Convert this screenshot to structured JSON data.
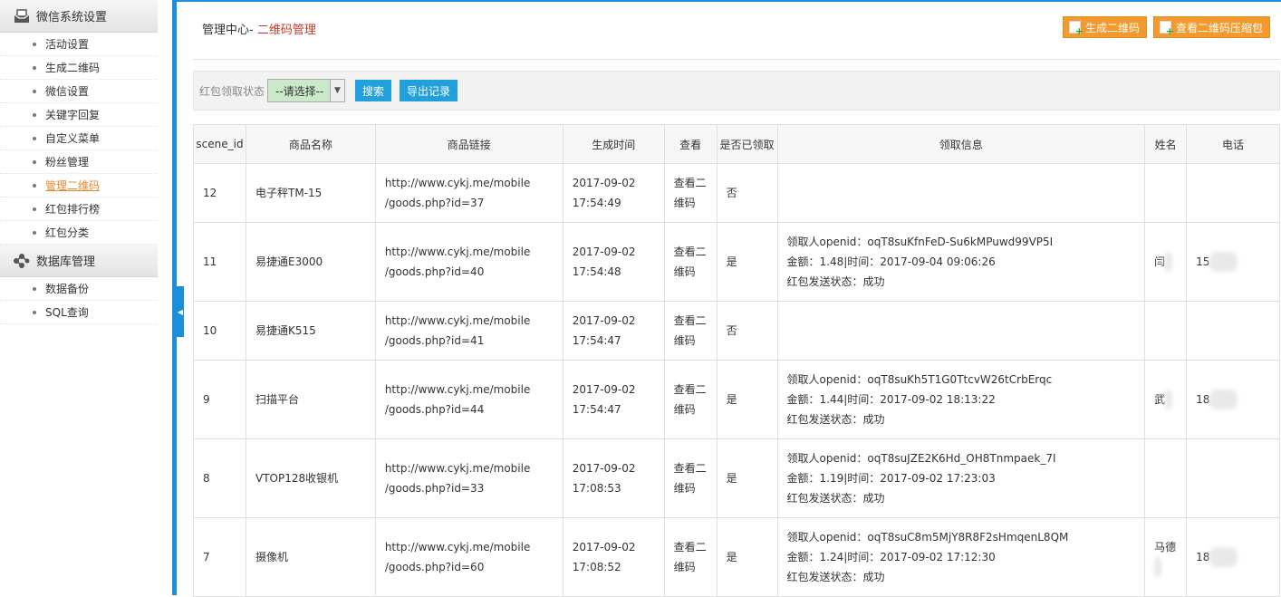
{
  "sidebar": {
    "groups": [
      {
        "title": "微信系统设置",
        "icon": "inbox-icon",
        "items": [
          "活动设置",
          "生成二维码",
          "微信设置",
          "关键字回复",
          "自定义菜单",
          "粉丝管理",
          "管理二维码",
          "红包排行榜",
          "红包分类"
        ]
      },
      {
        "title": "数据库管理",
        "icon": "share-nodes-icon",
        "items": [
          "数据备份",
          "SQL查询"
        ]
      }
    ],
    "active_item": "管理二维码"
  },
  "header": {
    "prefix": "管理中心-",
    "current": "二维码管理"
  },
  "actions": {
    "generate_qr": "生成二维码",
    "view_qr_zip": "查看二维码压缩包"
  },
  "filter": {
    "label": "红包领取状态",
    "select_value": "--请选择--",
    "search_btn": "搜索",
    "export_btn": "导出记录"
  },
  "table": {
    "headers": [
      "scene_id",
      "商品名称",
      "商品链接",
      "生成时间",
      "查看",
      "是否已领取",
      "领取信息",
      "姓名",
      "电话"
    ],
    "rows": [
      {
        "scene_id": "12",
        "name": "电子秤TM-15",
        "link1": "http://www.cykj.me/mobile",
        "link2": "/goods.php?id=37",
        "date": "2017-09-02",
        "time": "17:54:49",
        "view1": "查看二",
        "view2": "维码",
        "claimed": "否",
        "info": [],
        "person": "",
        "phone": ""
      },
      {
        "scene_id": "11",
        "name": "易捷通E3000",
        "link1": "http://www.cykj.me/mobile",
        "link2": "/goods.php?id=40",
        "date": "2017-09-02",
        "time": "17:54:48",
        "view1": "查看二",
        "view2": "维码",
        "claimed": "是",
        "info": [
          "领取人openid：oqT8suKfnFeD-Su6kMPuwd99VP5I",
          "金额：1.48|时间：2017-09-04 09:06:26",
          "红包发送状态：成功"
        ],
        "person": "闫",
        "phone": "15"
      },
      {
        "scene_id": "10",
        "name": "易捷通K515",
        "link1": "http://www.cykj.me/mobile",
        "link2": "/goods.php?id=41",
        "date": "2017-09-02",
        "time": "17:54:47",
        "view1": "查看二",
        "view2": "维码",
        "claimed": "否",
        "info": [],
        "person": "",
        "phone": ""
      },
      {
        "scene_id": "9",
        "name": "扫描平台",
        "link1": "http://www.cykj.me/mobile",
        "link2": "/goods.php?id=44",
        "date": "2017-09-02",
        "time": "17:54:47",
        "view1": "查看二",
        "view2": "维码",
        "claimed": "是",
        "info": [
          "领取人openid：oqT8suKh5T1G0TtcvW26tCrbErqc",
          "金额：1.44|时间：2017-09-02 18:13:22",
          "红包发送状态：成功"
        ],
        "person": "武",
        "phone": "18"
      },
      {
        "scene_id": "8",
        "name": "VTOP128收银机",
        "link1": "http://www.cykj.me/mobile",
        "link2": "/goods.php?id=33",
        "date": "2017-09-02",
        "time": "17:08:53",
        "view1": "查看二",
        "view2": "维码",
        "claimed": "是",
        "info": [
          "领取人openid：oqT8suJZE2K6Hd_OH8Tnmpaek_7I",
          "金额：1.19|时间：2017-09-02 17:23:03",
          "红包发送状态：成功"
        ],
        "person": "",
        "phone": ""
      },
      {
        "scene_id": "7",
        "name": "摄像机",
        "link1": "http://www.cykj.me/mobile",
        "link2": "/goods.php?id=60",
        "date": "2017-09-02",
        "time": "17:08:52",
        "view1": "查看二",
        "view2": "维码",
        "claimed": "是",
        "info": [
          "领取人openid：oqT8suC8m5MjY8R8F2sHmqenL8QM",
          "金额：1.24|时间：2017-09-02 17:12:30",
          "红包发送状态：成功"
        ],
        "person": "马德",
        "phone": "18"
      }
    ]
  },
  "colors": {
    "accent_blue": "#1d8fd8",
    "button_orange": "#f39a2e",
    "active_link": "#e8882b",
    "breadcrumb_current": "#c0392b"
  }
}
